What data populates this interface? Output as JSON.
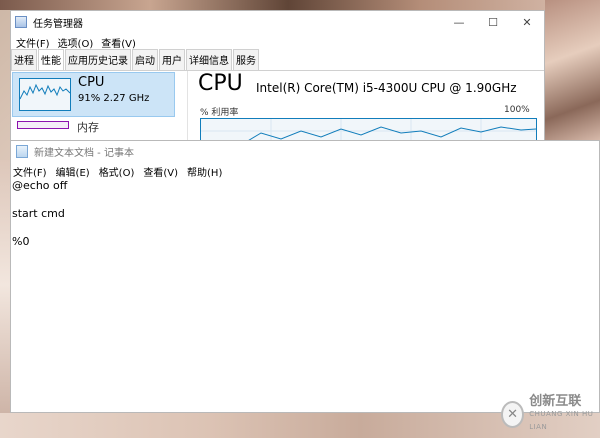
{
  "task_manager": {
    "title": "任务管理器",
    "menu": [
      "文件(F)",
      "选项(O)",
      "查看(V)"
    ],
    "tabs": [
      "进程",
      "性能",
      "应用历史记录",
      "启动",
      "用户",
      "详细信息",
      "服务"
    ],
    "active_tab": "性能",
    "cpu_tile": {
      "label": "CPU",
      "stats": "91%  2.27 GHz"
    },
    "memory_tile": {
      "label": "内存"
    },
    "cpu_heading": "CPU",
    "cpu_model": "Intel(R) Core(TM) i5-4300U CPU @ 1.90GHz",
    "util_label": "% 利用率",
    "util_max": "100%",
    "window_controls": {
      "minimize": "—",
      "maximize": "☐",
      "close": "✕"
    }
  },
  "notepad": {
    "title": "新建文本文档 - 记事本",
    "menu": [
      "文件(F)",
      "编辑(E)",
      "格式(O)",
      "查看(V)",
      "帮助(H)"
    ],
    "lines": [
      "@echo off",
      "",
      "start cmd",
      "",
      "%0"
    ]
  },
  "watermark": {
    "main": "创新互联",
    "sub": "CHUANG XIN HU LIAN",
    "logo_glyph": "✕"
  },
  "colors": {
    "tile_highlight": "#cce4f7",
    "cpu_graph": "#117dbb",
    "memory_graph": "#8b12ae"
  }
}
